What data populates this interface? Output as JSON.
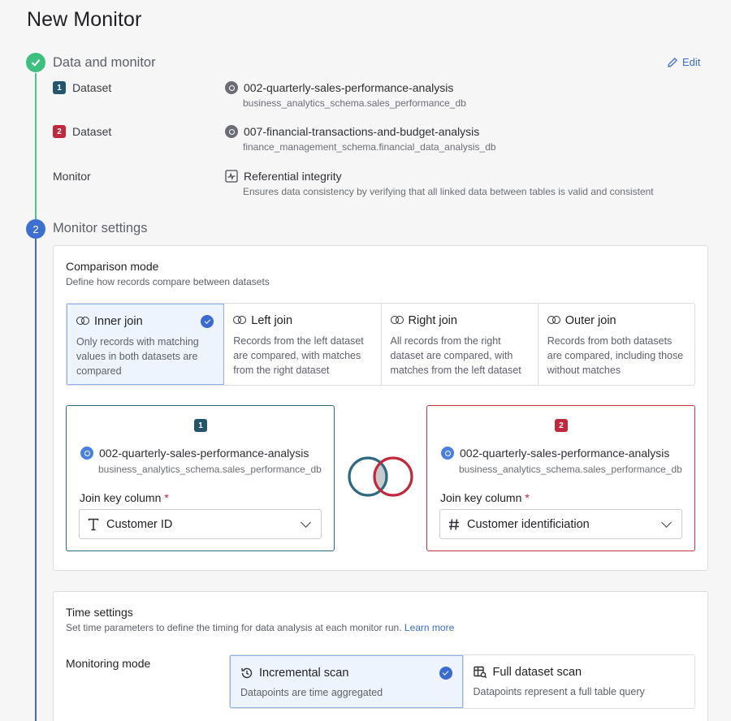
{
  "page_title": "New Monitor",
  "steps": [
    {
      "number": "",
      "title": "Data and monitor",
      "state": "complete",
      "edit_label": "Edit"
    },
    {
      "number": "2",
      "title": "Monitor settings",
      "state": "active"
    }
  ],
  "summary": {
    "dataset1": {
      "badge": "1",
      "label": "Dataset",
      "name": "002-quarterly-sales-performance-analysis",
      "schema": "business_analytics_schema.sales_performance_db"
    },
    "dataset2": {
      "badge": "2",
      "label": "Dataset",
      "name": "007-financial-transactions-and-budget-analysis",
      "schema": "finance_management_schema.financial_data_analysis_db"
    },
    "monitor": {
      "label": "Monitor",
      "name": "Referential integrity",
      "description": "Ensures data consistency by verifying that all linked data between tables is valid and consistent"
    }
  },
  "comparison": {
    "title": "Comparison mode",
    "subtitle": "Define how records compare between datasets",
    "options": [
      {
        "label": "Inner join",
        "desc": "Only records with matching values in both datasets are compared",
        "selected": true
      },
      {
        "label": "Left join",
        "desc": "Records from the left dataset are compared, with matches from the right dataset",
        "selected": false
      },
      {
        "label": "Right join",
        "desc": "All records from the right dataset are compared, with matches from the left dataset",
        "selected": false
      },
      {
        "label": "Outer join",
        "desc": "Records from both datasets are compared, including those without matches",
        "selected": false
      }
    ],
    "left": {
      "badge": "1",
      "name": "002-quarterly-sales-performance-analysis",
      "schema": "business_analytics_schema.sales_performance_db",
      "join_key_label": "Join key column",
      "required_mark": "*",
      "column_type_icon": "text-type-icon",
      "column_value": "Customer ID"
    },
    "right": {
      "badge": "2",
      "name": "002-quarterly-sales-performance-analysis",
      "schema": "business_analytics_schema.sales_performance_db",
      "join_key_label": "Join key column",
      "required_mark": "*",
      "column_type_icon": "number-type-icon",
      "column_value": "Customer identificiation"
    }
  },
  "time": {
    "title": "Time settings",
    "subtitle": "Set time parameters to define the timing for data analysis at each monitor run.",
    "learn_more": "Learn more",
    "mode_label": "Monitoring mode",
    "modes": [
      {
        "label": "Incremental scan",
        "desc": "Datapoints are time aggregated",
        "selected": true
      },
      {
        "label": "Full dataset scan",
        "desc": "Datapoints represent a full table query",
        "selected": false
      }
    ]
  },
  "colors": {
    "accent": "#3a6bd0",
    "complete": "#4ec48a",
    "dataset1": "#2e6980",
    "dataset2": "#cc3446"
  }
}
